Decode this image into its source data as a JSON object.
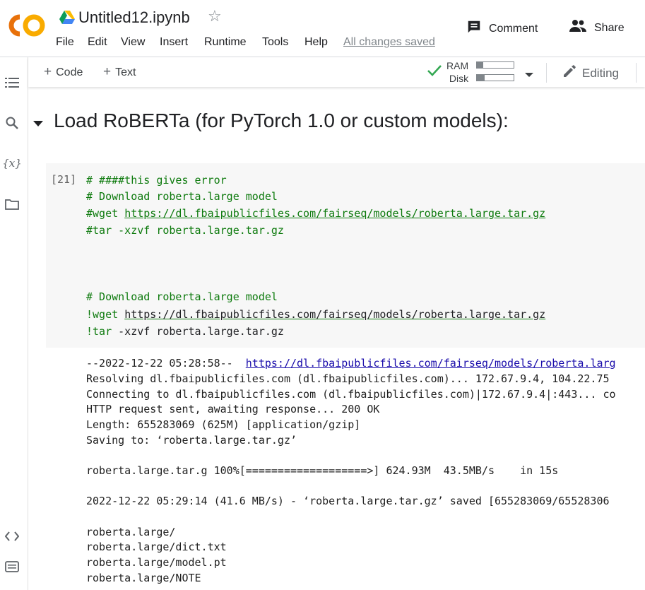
{
  "header": {
    "logo_text": "CO",
    "title": "Untitled12.ipynb",
    "menu": [
      "File",
      "Edit",
      "View",
      "Insert",
      "Runtime",
      "Tools",
      "Help"
    ],
    "saved_status": "All changes saved",
    "comment_label": "Comment",
    "share_label": "Share"
  },
  "toolbar": {
    "add_code_label": "Code",
    "add_text_label": "Text",
    "ram_label": "RAM",
    "disk_label": "Disk",
    "ram_usage_fraction": 0.18,
    "disk_usage_fraction": 0.22,
    "editing_label": "Editing"
  },
  "colors": {
    "logo_orange": "#F9AB00",
    "logo_dark_orange": "#E8710A",
    "code_comment_green": "#0d7a0d",
    "link_blue": "#1a0dab",
    "check_green": "#34a853"
  },
  "section": {
    "title": "Load RoBERTa (for PyTorch 1.0 or custom models):"
  },
  "cell": {
    "exec_count": "[21]",
    "lines": {
      "l1": "# ####this gives error",
      "l2": "# Download roberta.large model",
      "l3_prefix": "#wget ",
      "l3_url": "https://dl.fbaipublicfiles.com/fairseq/models/roberta.large.tar.gz",
      "l4": "#tar -xzvf roberta.large.tar.gz",
      "l5": "# Download roberta.large model",
      "l6_prefix": "!wget ",
      "l6_url": "https://dl.fbaipublicfiles.com/fairseq/models/roberta.large.tar.gz",
      "l7_prefix": "!tar",
      "l7_rest": " -xzvf roberta.large.tar.gz"
    }
  },
  "output": {
    "o1_prefix": "--2022-12-22 05:28:58--  ",
    "o1_url": "https://dl.fbaipublicfiles.com/fairseq/models/roberta.larg",
    "o2": "Resolving dl.fbaipublicfiles.com (dl.fbaipublicfiles.com)... 172.67.9.4, 104.22.75",
    "o3": "Connecting to dl.fbaipublicfiles.com (dl.fbaipublicfiles.com)|172.67.9.4|:443... co",
    "o4": "HTTP request sent, awaiting response... 200 OK",
    "o5": "Length: 655283069 (625M) [application/gzip]",
    "o6": "Saving to: ‘roberta.large.tar.gz’",
    "o7": "roberta.large.tar.g 100%[===================>] 624.93M  43.5MB/s    in 15s",
    "o8": "2022-12-22 05:29:14 (41.6 MB/s) - ‘roberta.large.tar.gz’ saved [655283069/65528306",
    "o9": "roberta.large/",
    "o10": "roberta.large/dict.txt",
    "o11": "roberta.large/model.pt",
    "o12": "roberta.large/NOTE"
  }
}
